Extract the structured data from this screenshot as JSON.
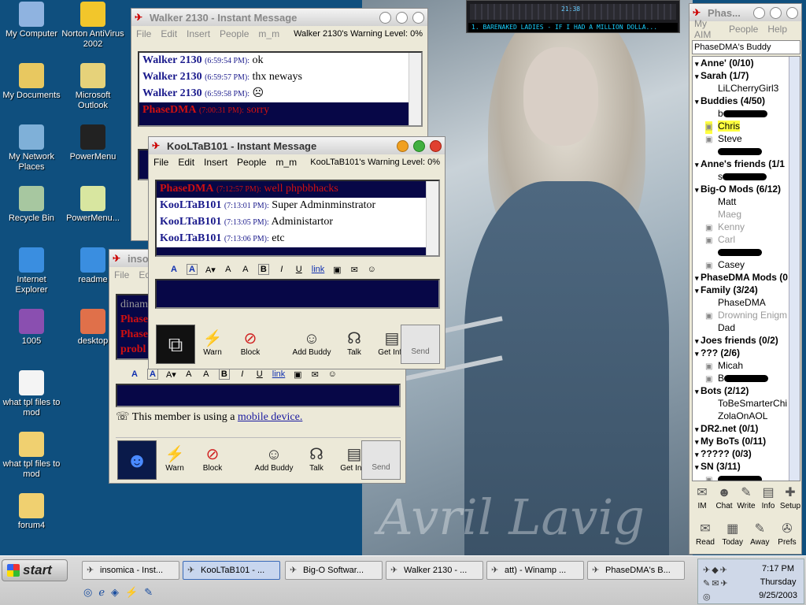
{
  "desktop": {
    "icons": [
      {
        "label": "My Computer",
        "icon": "computer-icon",
        "color": "#8fb3e0"
      },
      {
        "label": "Norton AntiVirus 2002",
        "icon": "norton-icon",
        "color": "#f2c62b"
      },
      {
        "label": "My Documents",
        "icon": "folder-documents-icon",
        "color": "#e8c860"
      },
      {
        "label": "Microsoft Outlook",
        "icon": "outlook-icon",
        "color": "#e6d27a"
      },
      {
        "label": "My Network Places",
        "icon": "network-icon",
        "color": "#7fb0d8"
      },
      {
        "label": "PowerMenu",
        "icon": "arrow-icon",
        "color": "#222222"
      },
      {
        "label": "Recycle Bin",
        "icon": "recycle-bin-icon",
        "color": "#a7c7a0"
      },
      {
        "label": "PowerMenu...",
        "icon": "powermenu-doc-icon",
        "color": "#d8e6a0"
      },
      {
        "label": "Internet Explorer",
        "icon": "ie-icon",
        "color": "#3a8ee0"
      },
      {
        "label": "readme",
        "icon": "ie-doc-icon",
        "color": "#3a8ee0"
      },
      {
        "label": "1005",
        "icon": "winrar-icon",
        "color": "#8a4fb0"
      },
      {
        "label": "desktop",
        "icon": "image-icon",
        "color": "#e0704a"
      },
      {
        "label": "what tpl files to mod",
        "icon": "text-file-icon",
        "color": "#f4f4f4"
      },
      {
        "label": "what tpl files to mod",
        "icon": "folder-icon",
        "color": "#f0d070"
      },
      {
        "label": "forum4",
        "icon": "folder-icon",
        "color": "#f0d070"
      }
    ],
    "wallpaper_text": "Avril Lavig"
  },
  "walker_window": {
    "title": "Walker 2130 - Instant Message",
    "menu": [
      "File",
      "Edit",
      "Insert",
      "People",
      "m_m"
    ],
    "warning": "Walker 2130's Warning Level: 0%",
    "messages": [
      {
        "name": "Walker 2130",
        "time": "(6:59:54 PM):",
        "text": "ok",
        "style": "incoming"
      },
      {
        "name": "Walker 2130",
        "time": "(6:59:57 PM):",
        "text": "thx neways",
        "style": "incoming"
      },
      {
        "name": "Walker 2130",
        "time": "(6:59:58 PM):",
        "text": "☹",
        "style": "incoming"
      },
      {
        "name": "PhaseDMA",
        "time": "(7:00:31 PM):",
        "text": "sorry",
        "style": "outgoing"
      }
    ]
  },
  "kooltab_window": {
    "title": "KooLTaB101 - Instant Message",
    "menu": [
      "File",
      "Edit",
      "Insert",
      "People",
      "m_m"
    ],
    "warning": "KooLTaB101's Warning Level: 0%",
    "messages": [
      {
        "name": "PhaseDMA",
        "time": "(7:12:57 PM):",
        "text": "well phpbbhacks",
        "style": "outgoing"
      },
      {
        "name": "KooLTaB101",
        "time": "(7:13:01 PM):",
        "text": "Super Adminminstrator",
        "style": "incoming"
      },
      {
        "name": "KooLTaB101",
        "time": "(7:13:05 PM):",
        "text": "Administartor",
        "style": "incoming"
      },
      {
        "name": "KooLTaB101",
        "time": "(7:13:06 PM):",
        "text": "etc",
        "style": "incoming"
      }
    ],
    "format": [
      "A",
      "A",
      "A▾",
      "A",
      "A",
      "B",
      "I",
      "U",
      "link",
      "▣",
      "✉",
      "☺"
    ],
    "tools": [
      {
        "label": "Warn",
        "icon": "warn-icon"
      },
      {
        "label": "Block",
        "icon": "block-icon"
      },
      {
        "label": "Add Buddy",
        "icon": "add-buddy-icon"
      },
      {
        "label": "Talk",
        "icon": "talk-icon"
      },
      {
        "label": "Get Info",
        "icon": "get-info-icon"
      }
    ],
    "send": "Send"
  },
  "insomica_window": {
    "title": "inso",
    "menu": [
      "File",
      "Ed"
    ],
    "visible_text": [
      "dinam",
      "Phase",
      "Phase",
      "probl"
    ],
    "mobile_notice": "This member is using a",
    "mobile_link": "mobile device.",
    "tools": [
      {
        "label": "Warn",
        "icon": "warn-icon"
      },
      {
        "label": "Block",
        "icon": "block-icon"
      },
      {
        "label": "Add Buddy",
        "icon": "add-buddy-icon"
      },
      {
        "label": "Talk",
        "icon": "talk-icon"
      },
      {
        "label": "Get Info",
        "icon": "get-info-icon"
      }
    ],
    "send": "Send"
  },
  "buddy_window": {
    "title": "Phas...",
    "menu": [
      "My AIM",
      "People",
      "Help"
    ],
    "screen_name": "PhaseDMA's Buddy",
    "rows": [
      {
        "kind": "group",
        "text": "Anne' (0/10)"
      },
      {
        "kind": "group",
        "text": "Sarah (1/7)"
      },
      {
        "kind": "buddy",
        "text": "LiLCherryGirl3"
      },
      {
        "kind": "group",
        "text": "Buddies (4/50)"
      },
      {
        "kind": "buddy",
        "text": "b",
        "scribble": true
      },
      {
        "kind": "buddy",
        "text": "Chris",
        "highlight": true,
        "icon": true
      },
      {
        "kind": "buddy",
        "text": "Steve",
        "icon": true
      },
      {
        "kind": "buddy",
        "text": "",
        "scribble": true
      },
      {
        "kind": "group",
        "text": "Anne's friends (1/1"
      },
      {
        "kind": "buddy",
        "text": "s",
        "scribble": true
      },
      {
        "kind": "group",
        "text": "Big-O Mods (6/12)"
      },
      {
        "kind": "buddy",
        "text": "Matt"
      },
      {
        "kind": "buddy",
        "text": "Maeg",
        "away": true
      },
      {
        "kind": "buddy",
        "text": "Kenny",
        "away": true,
        "icon": true
      },
      {
        "kind": "buddy",
        "text": "Carl",
        "away": true,
        "icon": true
      },
      {
        "kind": "buddy",
        "text": "",
        "scribble": true
      },
      {
        "kind": "buddy",
        "text": "Casey",
        "icon": true
      },
      {
        "kind": "group",
        "text": "PhaseDMA Mods (0"
      },
      {
        "kind": "group",
        "text": "Family (3/24)"
      },
      {
        "kind": "buddy",
        "text": "PhaseDMA"
      },
      {
        "kind": "buddy",
        "text": "Drowning Enigm",
        "away": true,
        "icon": true
      },
      {
        "kind": "buddy",
        "text": "Dad"
      },
      {
        "kind": "group",
        "text": "Joes friends (0/2)"
      },
      {
        "kind": "group",
        "text": "??? (2/6)"
      },
      {
        "kind": "buddy",
        "text": "Micah",
        "icon": true
      },
      {
        "kind": "buddy",
        "text": "B",
        "scribble": true,
        "icon": true
      },
      {
        "kind": "group",
        "text": "Bots (2/12)"
      },
      {
        "kind": "buddy",
        "text": "ToBeSmarterChi"
      },
      {
        "kind": "buddy",
        "text": "ZolaOnAOL"
      },
      {
        "kind": "group",
        "text": "DR2.net (0/1)"
      },
      {
        "kind": "group",
        "text": "My BoTs (0/11)"
      },
      {
        "kind": "group",
        "text": "????? (0/3)"
      },
      {
        "kind": "group",
        "text": "SN (3/11)"
      },
      {
        "kind": "buddy",
        "text": "",
        "scribble": true,
        "icon": true
      }
    ],
    "buttons_row1": [
      {
        "label": "IM",
        "icon": "im-icon"
      },
      {
        "label": "Chat",
        "icon": "chat-icon"
      },
      {
        "label": "Write",
        "icon": "write-icon"
      },
      {
        "label": "Info",
        "icon": "info-icon"
      },
      {
        "label": "Setup",
        "icon": "setup-icon"
      }
    ],
    "buttons_row2": [
      {
        "label": "Read",
        "icon": "read-icon"
      },
      {
        "label": "Today",
        "icon": "today-icon"
      },
      {
        "label": "Away",
        "icon": "away-icon"
      },
      {
        "label": "Prefs",
        "icon": "prefs-icon"
      }
    ]
  },
  "winamp": {
    "display": "1. BARENAKED LADIES - IF I HAD A MILLION DOLLA...",
    "time": "21:38"
  },
  "taskbar": {
    "start": "start",
    "tasks": [
      {
        "label": "insomica - Inst...",
        "active": false
      },
      {
        "label": "KooLTaB101 - ...",
        "active": true
      },
      {
        "label": "Big-O Softwar...",
        "active": false
      },
      {
        "label": "Walker 2130 - ...",
        "active": false
      },
      {
        "label": "att) - Winamp ...",
        "active": false
      },
      {
        "label": "PhaseDMA's B...",
        "active": false
      }
    ],
    "clock": {
      "time": "7:17 PM",
      "day": "Thursday",
      "date": "9/25/2003"
    }
  }
}
